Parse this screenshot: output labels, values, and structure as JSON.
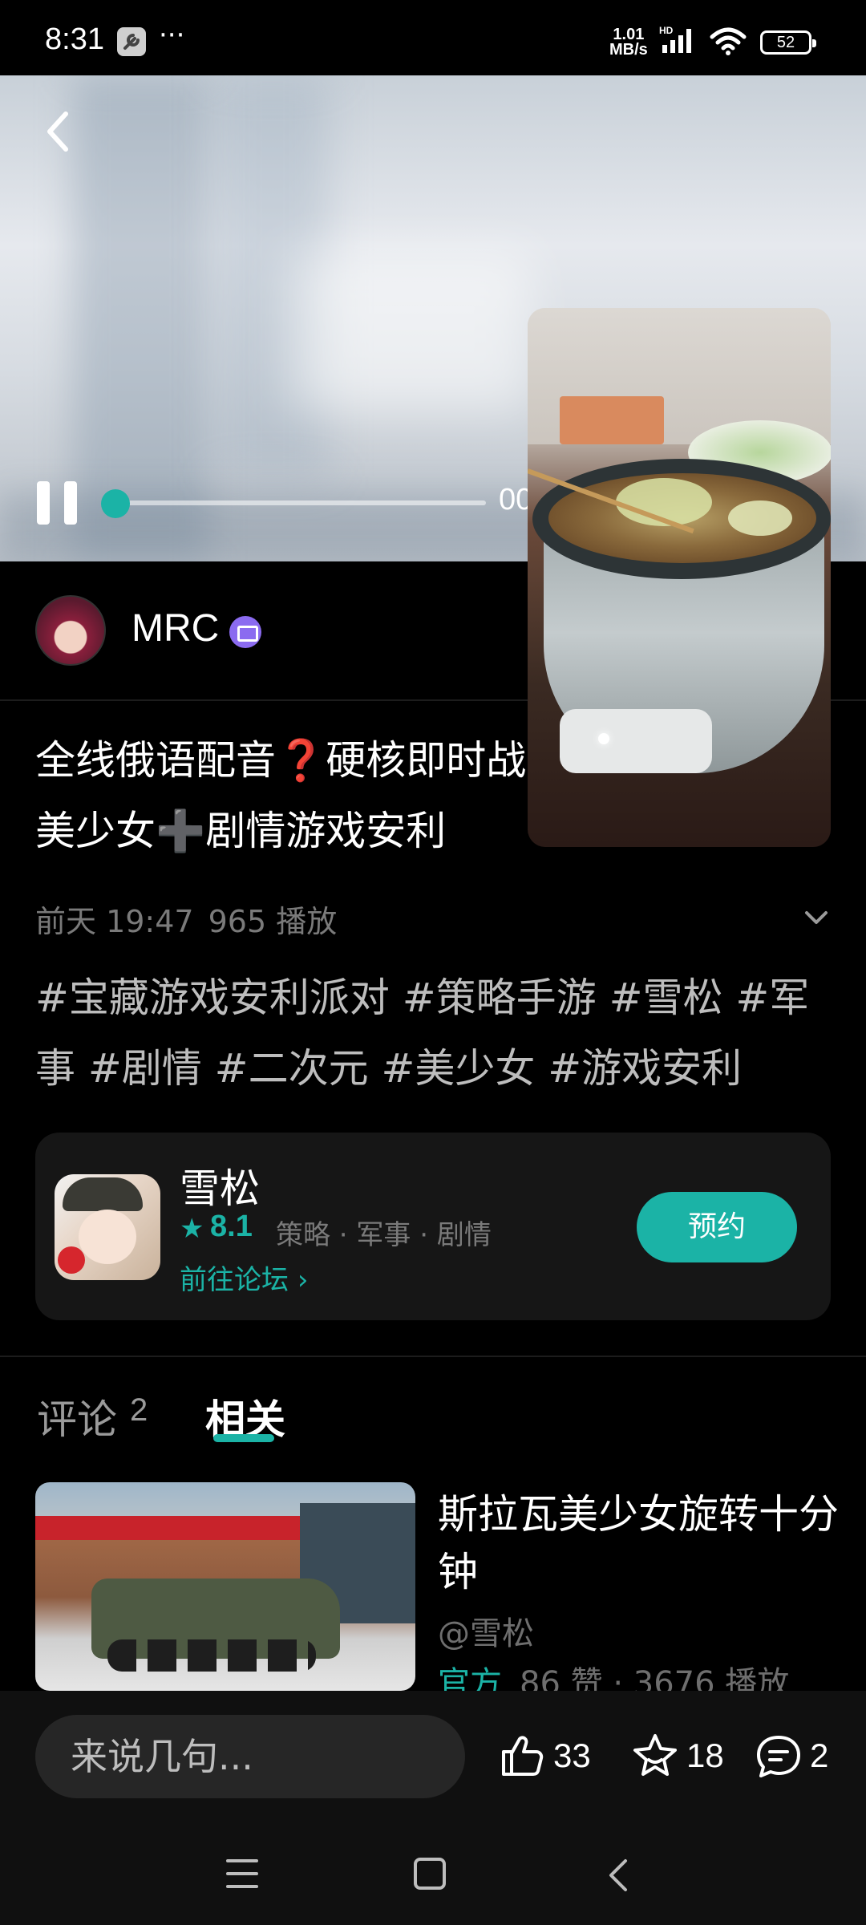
{
  "status_bar": {
    "time": "8:31",
    "speed_value": "1.01",
    "speed_unit": "MB/s",
    "network": "HD",
    "battery": "52"
  },
  "video": {
    "current_time": "00",
    "progress": 0.0
  },
  "author": {
    "name": "MRC"
  },
  "post": {
    "title": "全线俄语配音❓硬核即时战略➕二次元兽耳美少女➕剧情游戏安利",
    "date": "前天 19:47",
    "plays": "965 播放",
    "tags": "#宝藏游戏安利派对 #策略手游 #雪松 #军事 #剧情 #二次元 #美少女 #游戏安利"
  },
  "game": {
    "name": "雪松",
    "rating": "8.1",
    "genres": "策略 · 军事 · 剧情",
    "forum_link": "前往论坛",
    "reserve_label": "预约"
  },
  "tabs": {
    "comments_label": "评论",
    "comments_count": "2",
    "related_label": "相关"
  },
  "related": [
    {
      "title": "斯拉瓦美少女旋转十分钟",
      "author": "@雪松",
      "official": "官方",
      "stats": "86 赞 · 3676 播放"
    }
  ],
  "action_bar": {
    "comment_placeholder": "来说几句...",
    "likes": "33",
    "favorites": "18",
    "comments": "2"
  },
  "colors": {
    "accent": "#1bb3a6",
    "background": "#000000",
    "card": "#161616"
  }
}
